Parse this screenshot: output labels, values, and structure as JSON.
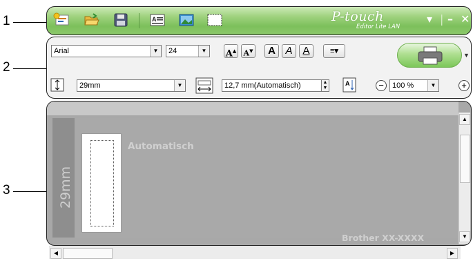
{
  "callouts": [
    "1",
    "2",
    "3"
  ],
  "titlebar": {
    "icons": [
      "new-label-icon",
      "open-folder-icon",
      "save-disk-icon",
      "insert-text-icon",
      "insert-image-icon",
      "insert-frame-icon"
    ],
    "logo_main": "P-touch",
    "logo_sub": "Editor Lite LAN",
    "controls": {
      "menu": "▾",
      "minimize": "–",
      "close": "✕"
    }
  },
  "toolbar": {
    "font_value": "Arial",
    "size_value": "24",
    "format_buttons": [
      "A+",
      "A-",
      "A",
      "A",
      "A"
    ],
    "tape_width": "29mm",
    "label_length": "12,7 mm(Automatisch)",
    "zoom_value": "100 %",
    "icons": [
      "grow-font-icon",
      "shrink-font-icon",
      "bold-icon",
      "italic-icon",
      "underline-icon",
      "align-icon",
      "print-icon",
      "tape-width-icon",
      "label-length-icon",
      "vertical-text-icon",
      "zoom-out-icon",
      "zoom-in-icon"
    ]
  },
  "canvas": {
    "tape_size_label": "29mm",
    "length_mode": "Automatisch",
    "printer_model": "Brother XX-XXXX"
  },
  "colors": {
    "titlebar_green": "#8cc86b",
    "canvas_gray": "#a8a8a8",
    "toolbar_bg": "#f2f2f2"
  }
}
